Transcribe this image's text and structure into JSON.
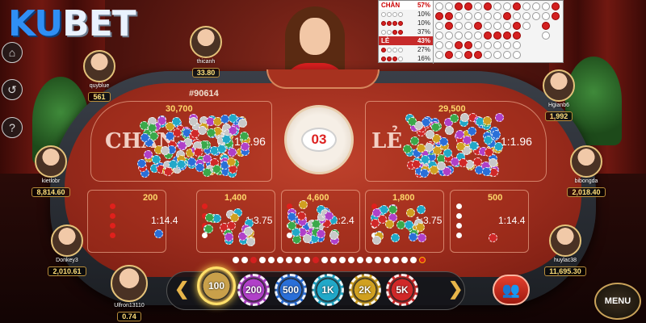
{
  "logo": {
    "part1": "KU",
    "part2": "BET"
  },
  "side_buttons": [
    {
      "icon": "home-icon",
      "glyph": "⌂"
    },
    {
      "icon": "history-icon",
      "glyph": "↺"
    },
    {
      "icon": "help-icon",
      "glyph": "?"
    }
  ],
  "round_id": "#90614",
  "result": "03",
  "board": {
    "even_label": "CHẴN",
    "even_pct": "57%",
    "even_rows": [
      "10%",
      "10%",
      "37%"
    ],
    "odd_label": "LẺ",
    "odd_pct": "43%",
    "odd_rows": [
      "27%",
      "16%"
    ]
  },
  "zones": {
    "even": {
      "label": "CHẴN",
      "odds": "1:1.96",
      "bet": "30,700"
    },
    "odd": {
      "label": "LẺ",
      "odds": "1:1.96",
      "bet": "29,500"
    },
    "small": [
      {
        "bet": "200",
        "odds": "1:14.4"
      },
      {
        "bet": "1,400",
        "odds": "1:3.75"
      },
      {
        "bet": "4,600",
        "odds": "1:2.4"
      },
      {
        "bet": "1,800",
        "odds": "1:3.75"
      },
      {
        "bet": "500",
        "odds": "1:14.4"
      }
    ]
  },
  "players": [
    {
      "id": "quyblue",
      "name": "quyblue",
      "balance": "561"
    },
    {
      "id": "thicanh",
      "name": "thicanh",
      "balance": "33.80"
    },
    {
      "id": "kietlobr",
      "name": "kietlobr",
      "balance": "8,814.60"
    },
    {
      "id": "donkey",
      "name": "Donkey3",
      "balance": "2,010.61"
    },
    {
      "id": "hgianb",
      "name": "Hgianb6",
      "balance": "1,992"
    },
    {
      "id": "bibongda",
      "name": "bibongda",
      "balance": "2,018.40"
    },
    {
      "id": "huylac",
      "name": "huylac38",
      "balance": "11,695.30"
    },
    {
      "id": "me",
      "name": "Ulfron13110",
      "balance": "0.74"
    }
  ],
  "chips": [
    {
      "label": "100",
      "color": "#c9a04a",
      "selected": true
    },
    {
      "label": "200",
      "color": "#b040c8"
    },
    {
      "label": "500",
      "color": "#2a6fd8"
    },
    {
      "label": "1K",
      "color": "#21a8c8"
    },
    {
      "label": "2K",
      "color": "#d0a020"
    },
    {
      "label": "5K",
      "color": "#d02828"
    }
  ],
  "menu_label": "MENU",
  "colors": {
    "accent": "#e8b64a",
    "even": "#ffffff",
    "odd": "#d42020",
    "balance": "#ffe07a"
  }
}
